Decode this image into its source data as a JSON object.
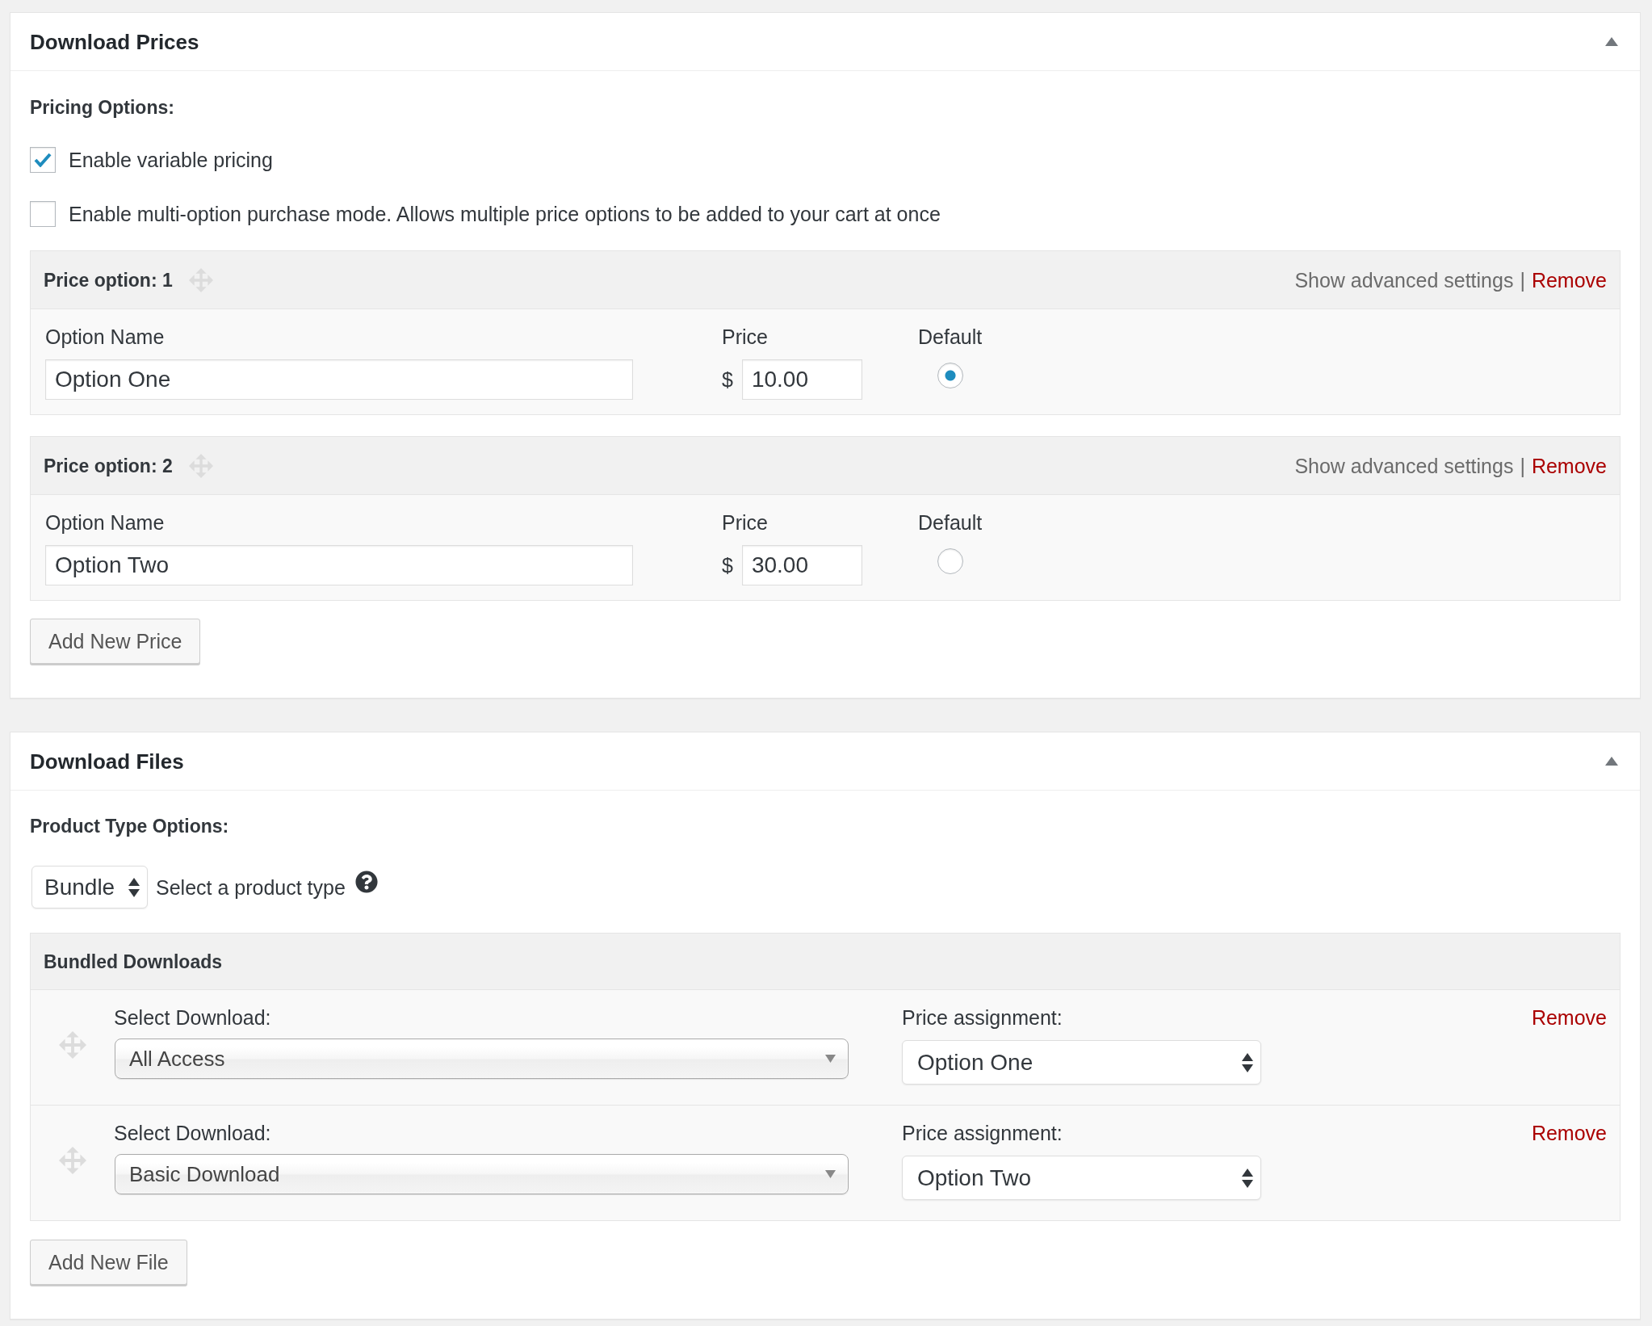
{
  "download_prices": {
    "title": "Download Prices",
    "expanded": true,
    "pricing_label": "Pricing Options:",
    "options": [
      {
        "label": "Enable variable pricing",
        "checked": true
      },
      {
        "label": "Enable multi-option purchase mode. Allows multiple price options to be added to your cart at once",
        "checked": false
      }
    ],
    "price_options": [
      {
        "title": "Price option: 1",
        "advanced_link": "Show advanced settings",
        "separator": "|",
        "remove_link": "Remove",
        "name_label": "Option Name",
        "name_value": "Option One",
        "price_label": "Price",
        "currency": "$",
        "price_value": "10.00",
        "default_label": "Default",
        "selected": true
      },
      {
        "title": "Price option: 2",
        "advanced_link": "Show advanced settings",
        "separator": "|",
        "remove_link": "Remove",
        "name_label": "Option Name",
        "name_value": "Option Two",
        "price_label": "Price",
        "currency": "$",
        "price_value": "30.00",
        "default_label": "Default",
        "selected": false
      }
    ],
    "add_button": "Add New Price"
  },
  "download_files": {
    "title": "Download Files",
    "expanded": true,
    "product_type_label": "Product Type Options:",
    "product_type": {
      "value": "Bundle",
      "hint": "Select a product type"
    },
    "bundled_downloads": {
      "title": "Bundled Downloads",
      "rows": [
        {
          "download_label": "Select Download:",
          "download": "All Access",
          "price_label": "Price assignment:",
          "price": "Option One",
          "remove_link": "Remove"
        },
        {
          "download_label": "Select Download:",
          "download": "Basic Download",
          "price_label": "Price assignment:",
          "price": "Option Two",
          "remove_link": "Remove"
        }
      ]
    },
    "add_button": "Add New File"
  }
}
